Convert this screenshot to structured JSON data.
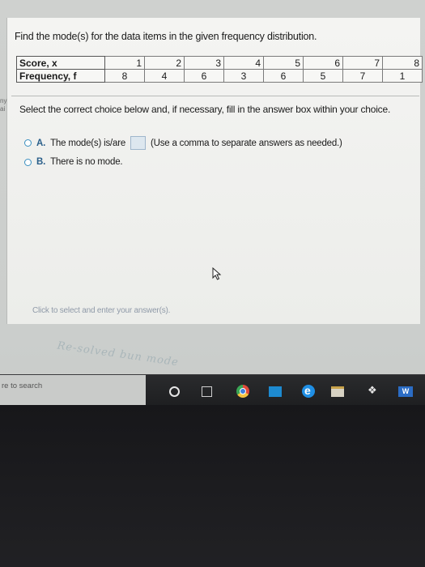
{
  "question": "Find the mode(s) for the data items in the given frequency distribution.",
  "table": {
    "score_label": "Score, x",
    "freq_label": "Frequency, f",
    "scores": [
      "1",
      "2",
      "3",
      "4",
      "5",
      "6",
      "7",
      "8"
    ],
    "frequencies": [
      "8",
      "4",
      "6",
      "3",
      "6",
      "5",
      "7",
      "1"
    ]
  },
  "side_marks": [
    "ny",
    "ai"
  ],
  "instruction": "Select the correct choice below and, if necessary, fill in the answer box within your choice.",
  "choice_a": {
    "letter": "A.",
    "text": "The mode(s) is/are",
    "note": "(Use a comma to separate answers as needed.)"
  },
  "choice_b": {
    "letter": "B.",
    "text": "There is no mode."
  },
  "hint": "Click to select and enter your answer(s).",
  "handwriting": "Re-solved bun mode",
  "taskbar": {
    "search_text": "re to search",
    "word_label": "W"
  },
  "colors": {
    "accent": "#3a8fbf",
    "panel": "#f4f4f2",
    "taskbar": "#1e1f21"
  }
}
